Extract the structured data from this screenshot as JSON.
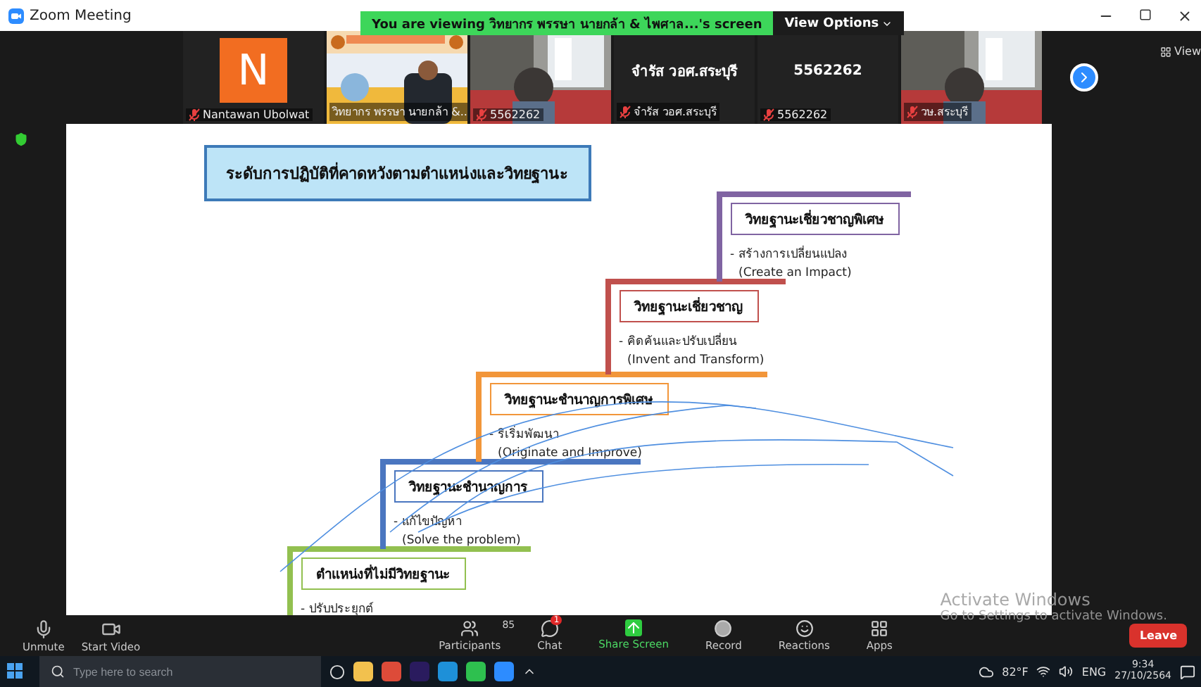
{
  "window": {
    "title": "Zoom Meeting"
  },
  "banner": {
    "text": "You are viewing วิทยากร พรรษา นายกล้า & ไพศาล...'s screen",
    "button": "View Options"
  },
  "video_tiles": [
    {
      "kind": "avatar",
      "initial": "N",
      "name": "Nantawan Ubolwat",
      "muted": true
    },
    {
      "kind": "screen",
      "name": "วิทยากร พรรษา นายกล้า &...",
      "muted": false
    },
    {
      "kind": "video",
      "name": "5562262",
      "muted": true
    },
    {
      "kind": "name",
      "display": "จำรัส วอศ.สระบุรี",
      "name": "จำรัส วอศ.สระบุรี",
      "muted": true
    },
    {
      "kind": "name",
      "display": "5562262",
      "name": "5562262",
      "muted": true
    },
    {
      "kind": "video",
      "name": "วษ.สระบุรี",
      "muted": true
    }
  ],
  "view_label": "View",
  "slide": {
    "title": "ระดับการปฏิบัติที่คาดหวังตามตำแหน่งและวิทยฐานะ",
    "steps": [
      {
        "heading": "ตำแหน่งที่ไม่มีวิทยฐานะ",
        "bullet": "- ปรับประยุกต์",
        "color": "#92c050"
      },
      {
        "heading": "วิทยฐานะชำนาญการ",
        "bullet": "- แก้ไขปัญหา",
        "english": "(Solve the problem)",
        "color": "#4a76c0"
      },
      {
        "heading": "วิทยฐานะชำนาญการพิเศษ",
        "bullet": "- ริเริ่มพัฒนา",
        "english": "(Originate and Improve)",
        "color": "#f2963a"
      },
      {
        "heading": "วิทยฐานะเชี่ยวชาญ",
        "bullet": "- คิดค้นและปรับเปลี่ยน",
        "english": "(Invent and Transform)",
        "color": "#c0504d"
      },
      {
        "heading": "วิทยฐานะเชี่ยวชาญพิเศษ",
        "bullet": "- สร้างการเปลี่ยนแปลง",
        "english": "(Create an Impact)",
        "color": "#8064a2"
      }
    ]
  },
  "activation": {
    "title": "Activate Windows",
    "hint": "Go to Settings to activate Windows."
  },
  "toolbar": {
    "left": [
      {
        "kind": "mic",
        "label": "Unmute"
      },
      {
        "kind": "video",
        "label": "Start Video"
      }
    ],
    "center": [
      {
        "kind": "participants",
        "label": "Participants",
        "count": "85"
      },
      {
        "kind": "chat",
        "label": "Chat",
        "badge": "1"
      },
      {
        "kind": "share",
        "label": "Share Screen"
      },
      {
        "kind": "record",
        "label": "Record"
      },
      {
        "kind": "reactions",
        "label": "Reactions"
      },
      {
        "kind": "apps",
        "label": "Apps"
      }
    ],
    "leave": "Leave"
  },
  "taskbar": {
    "search_placeholder": "Type here to search",
    "temperature": "82°F",
    "language": "ENG",
    "time": "9:34",
    "date": "27/10/2564"
  }
}
